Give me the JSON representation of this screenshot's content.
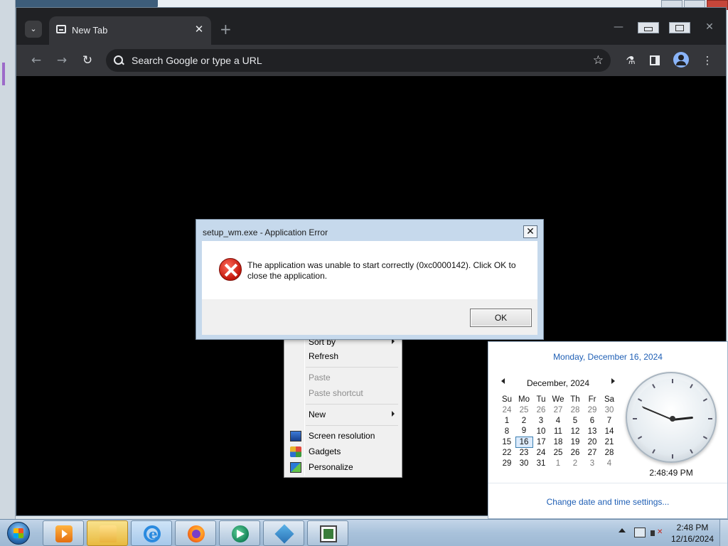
{
  "browser": {
    "tab_title": "New Tab",
    "omnibox_placeholder": "Search Google or type a URL"
  },
  "context_menu": {
    "items": [
      {
        "label": "Sort by",
        "disabled": false,
        "submenu": true
      },
      {
        "label": "Refresh",
        "disabled": false,
        "submenu": false
      },
      {
        "label": "Paste",
        "disabled": true,
        "submenu": false
      },
      {
        "label": "Paste shortcut",
        "disabled": true,
        "submenu": false
      },
      {
        "label": "New",
        "disabled": false,
        "submenu": true
      },
      {
        "label": "Screen resolution",
        "disabled": false,
        "submenu": false,
        "icon": "screen-resolution-icon"
      },
      {
        "label": "Gadgets",
        "disabled": false,
        "submenu": false,
        "icon": "gadgets-icon"
      },
      {
        "label": "Personalize",
        "disabled": false,
        "submenu": false,
        "icon": "personalize-icon"
      }
    ]
  },
  "error_dialog": {
    "title": "setup_wm.exe - Application Error",
    "message": "The application was unable to start correctly (0xc0000142). Click OK to close the application.",
    "ok_label": "OK",
    "close_label": "✕"
  },
  "calendar": {
    "long_date": "Monday, December 16, 2024",
    "month_title": "December, 2024",
    "weekdays": [
      "Su",
      "Mo",
      "Tu",
      "We",
      "Th",
      "Fr",
      "Sa"
    ],
    "weeks": [
      [
        "24",
        "25",
        "26",
        "27",
        "28",
        "29",
        "30"
      ],
      [
        "1",
        "2",
        "3",
        "4",
        "5",
        "6",
        "7"
      ],
      [
        "8",
        "9",
        "10",
        "11",
        "12",
        "13",
        "14"
      ],
      [
        "15",
        "16",
        "17",
        "18",
        "19",
        "20",
        "21"
      ],
      [
        "22",
        "23",
        "24",
        "25",
        "26",
        "27",
        "28"
      ],
      [
        "29",
        "30",
        "31",
        "1",
        "2",
        "3",
        "4"
      ]
    ],
    "today": "16",
    "time_label": "2:48:49 PM",
    "clock": {
      "hour": 14,
      "minute": 48,
      "second": 49
    },
    "change_link": "Change date and time settings..."
  },
  "taskbar": {
    "buttons": [
      "media-player-icon",
      "file-explorer-icon",
      "internet-explorer-icon",
      "firefox-icon",
      "app-icon",
      "setup-icon",
      "window-icon"
    ],
    "time": "2:48 PM",
    "date": "12/16/2024"
  },
  "colors": {
    "chrome_frame": "#202124",
    "chrome_toolbar": "#35363a",
    "link_blue": "#1f5fb5",
    "error_red": "#c2150a"
  }
}
